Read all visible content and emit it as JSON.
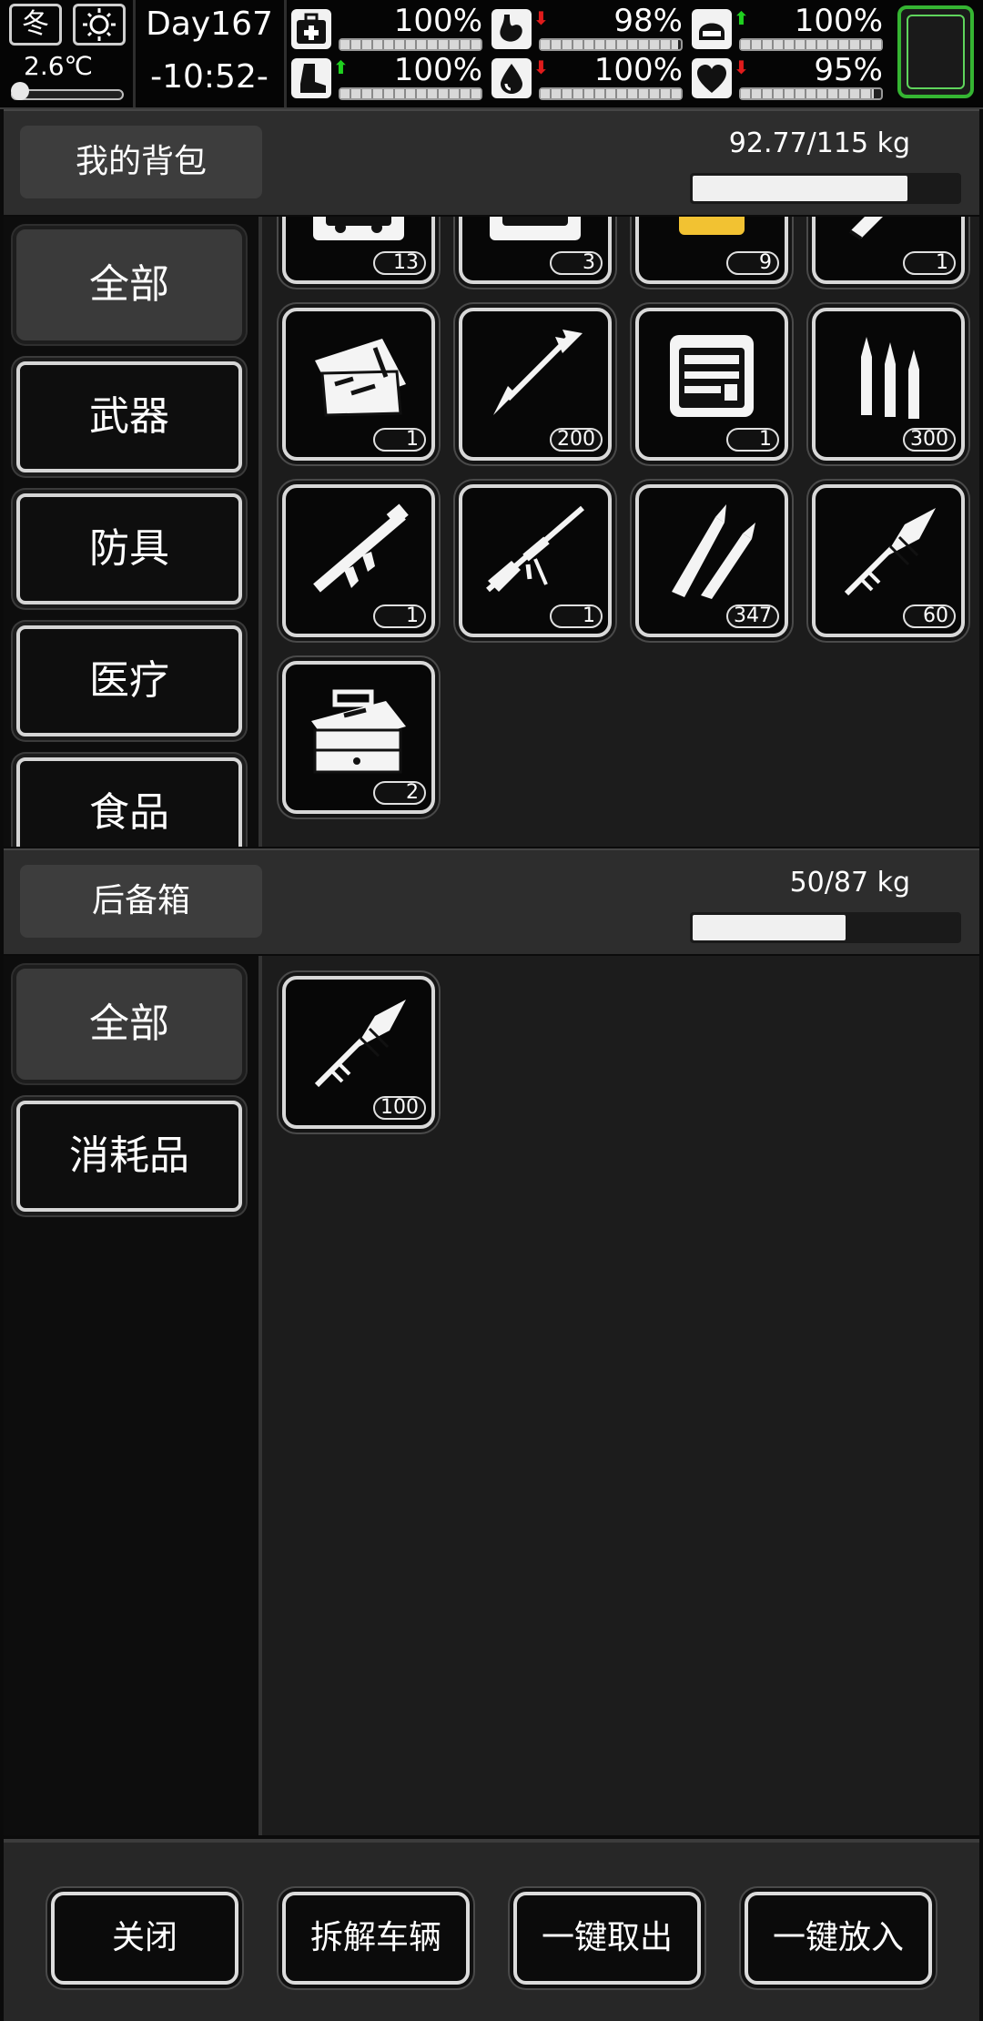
{
  "status": {
    "season": "冬",
    "temperature": "2.6℃",
    "temperature_level": 0.08,
    "day": "Day167",
    "clock": "-10:52-",
    "stats": [
      {
        "name": "health",
        "icon": "medkit-icon",
        "arrow": "",
        "percent": "100%",
        "level": 1.0
      },
      {
        "name": "hunger",
        "icon": "stomach-icon",
        "arrow": "down",
        "percent": "98%",
        "level": 0.98
      },
      {
        "name": "armor",
        "icon": "helmet-icon",
        "arrow": "up",
        "percent": "100%",
        "level": 1.0
      },
      {
        "name": "stamina",
        "icon": "boot-icon",
        "arrow": "up",
        "percent": "100%",
        "level": 1.0
      },
      {
        "name": "thirst",
        "icon": "water-drop-icon",
        "arrow": "down",
        "percent": "100%",
        "level": 1.0
      },
      {
        "name": "mood",
        "icon": "heart-icon",
        "arrow": "down",
        "percent": "95%",
        "level": 0.95
      }
    ]
  },
  "backpack": {
    "title": "我的背包",
    "weight": "92.77/115 kg",
    "weight_level": 0.8067,
    "categories": [
      "全部",
      "武器",
      "防具",
      "医疗",
      "食品"
    ],
    "active_category": 0,
    "items": [
      {
        "icon": "car-toolbox-icon",
        "count": "13"
      },
      {
        "icon": "car-repair-kit-icon",
        "count": "3"
      },
      {
        "icon": "jar-icon",
        "count": "9"
      },
      {
        "icon": "shell-icon",
        "count": "1"
      },
      {
        "icon": "tool-case-icon",
        "count": "1"
      },
      {
        "icon": "arrow-icon",
        "count": "200"
      },
      {
        "icon": "precision-tool-kit-icon",
        "count": "1"
      },
      {
        "icon": "rifle-ammo-icon",
        "count": "300"
      },
      {
        "icon": "rocket-launcher-icon",
        "count": "1"
      },
      {
        "icon": "sniper-rifle-icon",
        "count": "1"
      },
      {
        "icon": "bullets-icon",
        "count": "347"
      },
      {
        "icon": "rocket-warhead-icon",
        "count": "60"
      },
      {
        "icon": "toolbox-icon",
        "count": "2"
      }
    ]
  },
  "trunk": {
    "title": "后备箱",
    "weight": "50/87 kg",
    "weight_level": 0.5747,
    "categories": [
      "全部",
      "消耗品"
    ],
    "active_category": 0,
    "items": [
      {
        "icon": "rocket-warhead-icon",
        "count": "100"
      }
    ]
  },
  "footer": {
    "close": "关闭",
    "dismantle": "拆解车辆",
    "take_all": "一键取出",
    "put_all": "一键放入"
  }
}
